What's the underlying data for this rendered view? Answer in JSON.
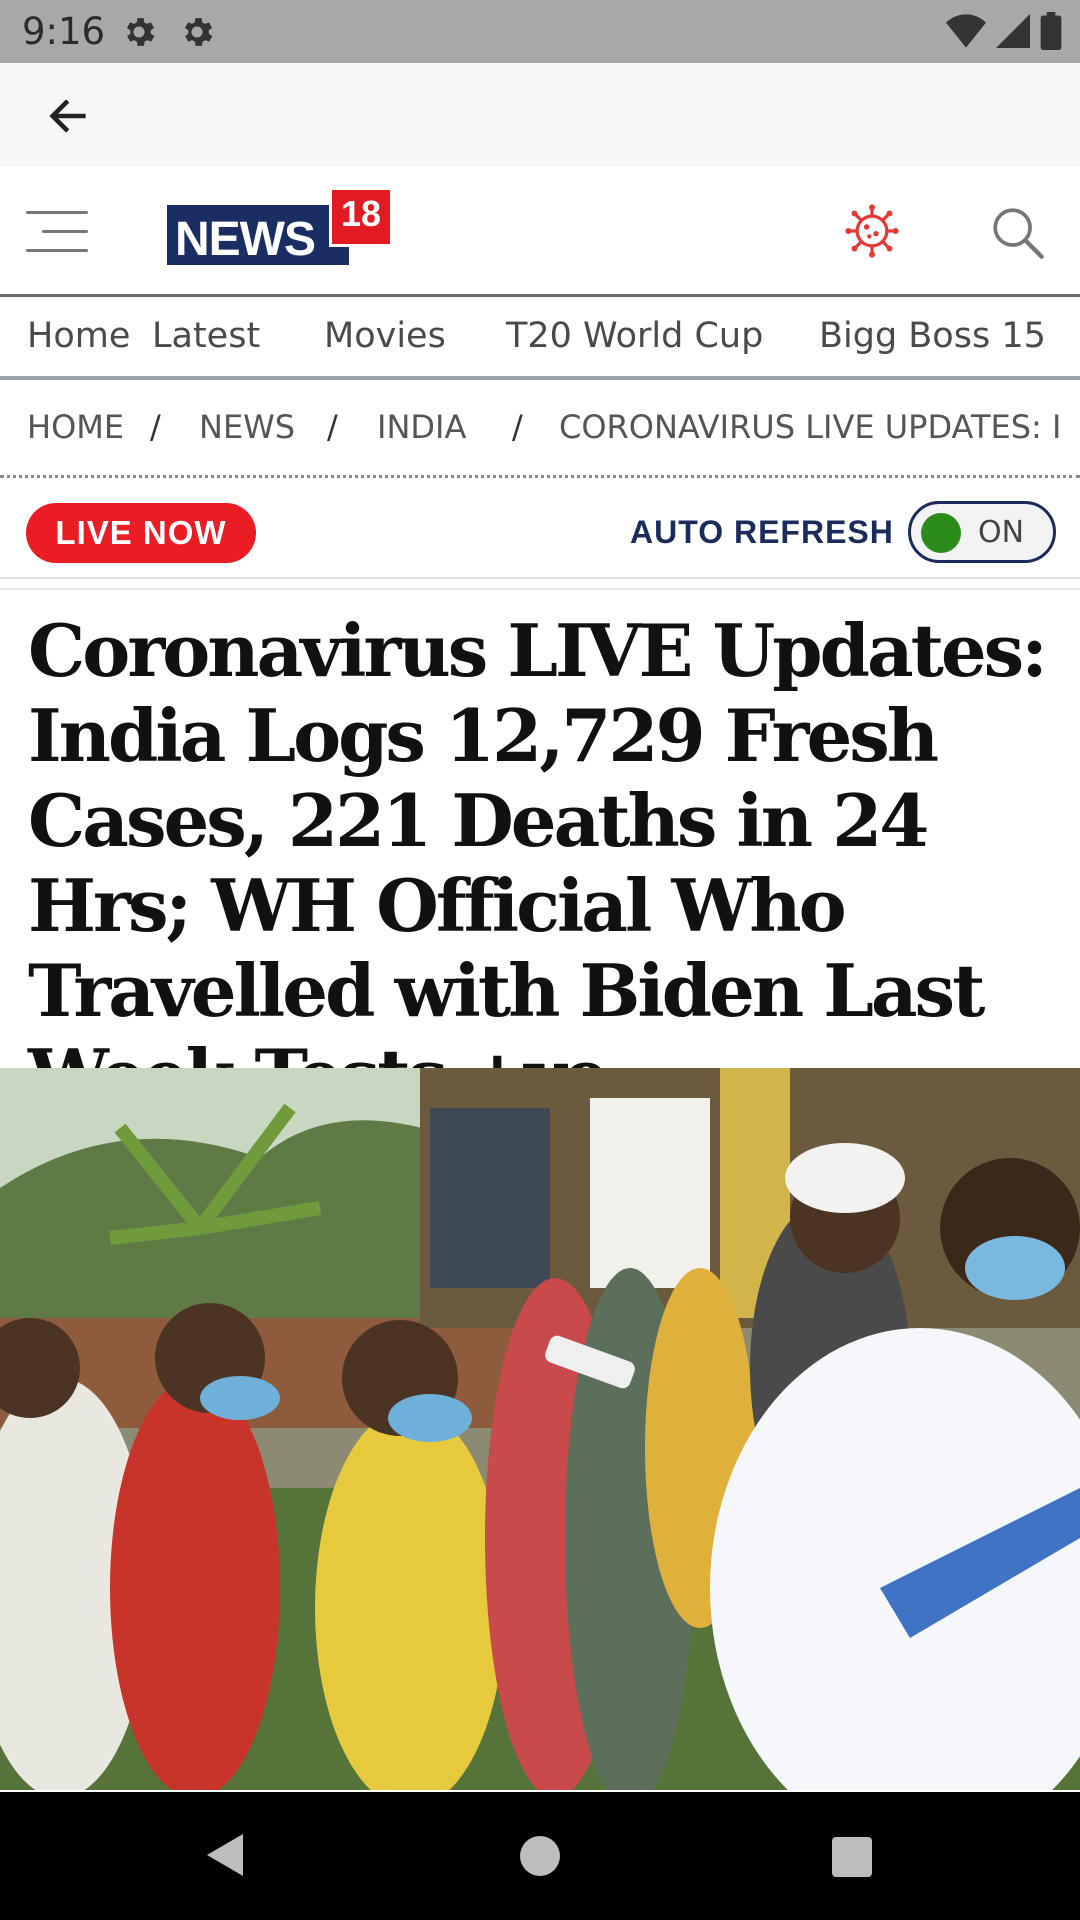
{
  "status_bar": {
    "time": "9:16"
  },
  "header": {
    "logo_text": "NEWS",
    "logo_number": "18"
  },
  "nav_menu": {
    "items": [
      "Home",
      "Latest",
      "Movies",
      "T20 World Cup",
      "Bigg Boss 15"
    ]
  },
  "breadcrumb": {
    "items": [
      "HOME",
      "NEWS",
      "INDIA",
      "CORONAVIRUS LIVE UPDATES: I"
    ],
    "separator": "/"
  },
  "live": {
    "badge": "LIVE NOW",
    "auto_refresh_label": "AUTO REFRESH",
    "toggle_state": "ON"
  },
  "article": {
    "headline": "Coronavirus LIVE Updates: India Logs 12,729 Fresh Cases, 221 Deaths in 24 Hrs; WH Official Who Travelled with Biden Last Week Tests +ve"
  },
  "colors": {
    "brand_navy": "#1a2e63",
    "brand_red": "#e21b23",
    "live_red": "#ea1c24",
    "toggle_green": "#2b8c1b"
  },
  "icons": [
    "gear-icon",
    "wifi-icon",
    "signal-icon",
    "battery-icon",
    "back-arrow-icon",
    "hamburger-icon",
    "coronavirus-icon",
    "search-icon"
  ]
}
